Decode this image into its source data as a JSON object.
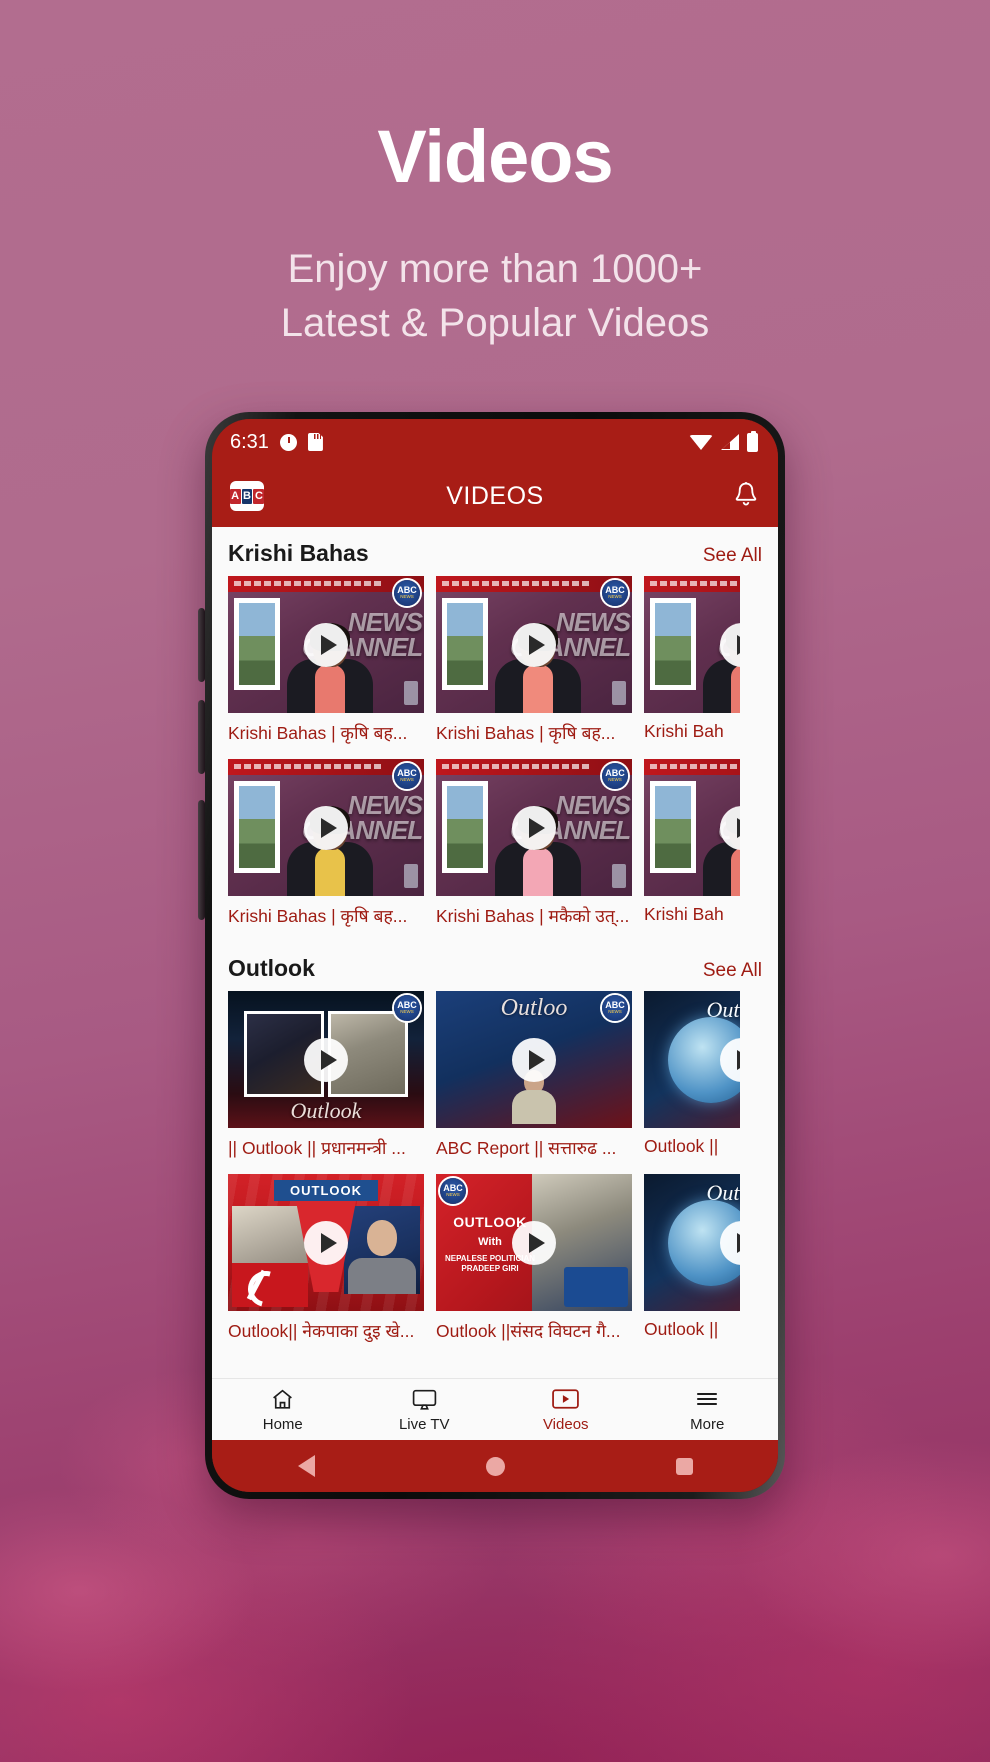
{
  "hero": {
    "title": "Videos",
    "subtitle_line1": "Enjoy more than 1000+",
    "subtitle_line2": "Latest & Popular Videos"
  },
  "phone": {
    "status_bar": {
      "time": "6:31",
      "left_icons": [
        "clock-icon",
        "sd-card-icon"
      ],
      "right_icons": [
        "wifi-icon",
        "cellular-signal-icon",
        "battery-icon"
      ]
    },
    "app_bar": {
      "logo_letters": [
        "A",
        "B",
        "C"
      ],
      "title": "VIDEOS",
      "notification_icon": "bell-icon"
    },
    "sections": [
      {
        "title": "Krishi Bahas",
        "see_all": "See All",
        "rows": [
          [
            {
              "caption": "Krishi Bahas | कृषि बह...",
              "thumb": "studio",
              "play": "play-icon"
            },
            {
              "caption": "Krishi Bahas | कृषि बह...",
              "thumb": "studio",
              "play": "play-icon"
            },
            {
              "caption": "Krishi Bah",
              "thumb": "studio",
              "play": "play-icon"
            }
          ],
          [
            {
              "caption": "Krishi  Bahas | कृषि बह...",
              "thumb": "studio",
              "play": "play-icon"
            },
            {
              "caption": "Krishi Bahas | मकैको उत्...",
              "thumb": "studio",
              "play": "play-icon"
            },
            {
              "caption": "Krishi Bah",
              "thumb": "studio",
              "play": "play-icon"
            }
          ]
        ]
      },
      {
        "title": "Outlook",
        "see_all": "See All",
        "rows": [
          [
            {
              "caption": "|| Outlook ||  प्रधानमन्त्री ...",
              "thumb": "outlook-interview",
              "play": "play-icon",
              "overlay": "Outlook"
            },
            {
              "caption": "ABC Report  || सत्तारुढ ...",
              "thumb": "outlook-studio",
              "play": "play-icon",
              "overlay": "Outloo"
            },
            {
              "caption": "Outlook ||",
              "thumb": "outlook-clock",
              "play": "play-icon",
              "overlay": "Outlook"
            }
          ],
          [
            {
              "caption": "Outlook|| नेकपाका दुइ खे...",
              "thumb": "outlook-political",
              "play": "play-icon",
              "overlay": "OUTLOOK"
            },
            {
              "caption": "Outlook ||संसद विघटन गै...",
              "thumb": "outlook-pradeep",
              "play": "play-icon",
              "overlay": "OUTLOOK With NEPALESE POLITICIAN PRADEEP GIRI"
            },
            {
              "caption": "Outlook ||",
              "thumb": "outlook-clock",
              "play": "play-icon",
              "overlay": "Outlook"
            }
          ]
        ]
      }
    ],
    "bottom_nav": [
      {
        "label": "Home",
        "icon": "home-icon",
        "active": false
      },
      {
        "label": "Live TV",
        "icon": "tv-monitor-icon",
        "active": false
      },
      {
        "label": "Videos",
        "icon": "video-play-icon",
        "active": true
      },
      {
        "label": "More",
        "icon": "hamburger-menu-icon",
        "active": false
      }
    ],
    "android_nav": [
      "back-icon",
      "home-circle-icon",
      "recents-square-icon"
    ]
  },
  "colors": {
    "brand_red": "#a81d16",
    "accent_link": "#9e1b12",
    "bg_pink": "#b26d8f",
    "panel": "#fafafa"
  }
}
